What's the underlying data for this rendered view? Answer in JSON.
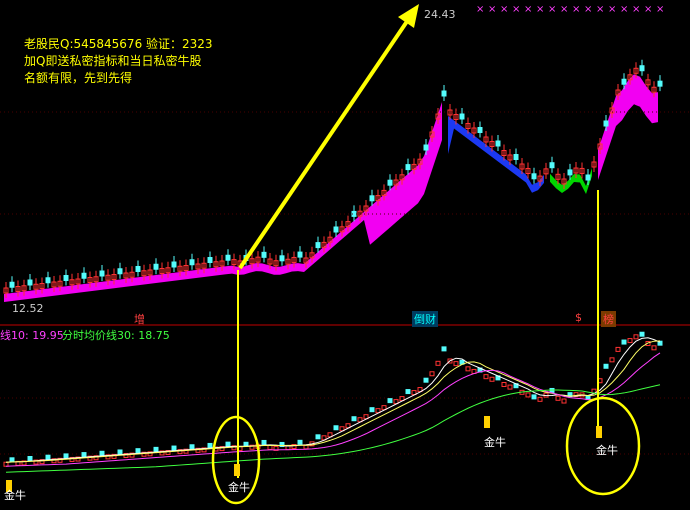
{
  "chart_data": {
    "type": "candlestick",
    "indicator_header": {
      "ma10_label": "线10: 19.95",
      "ma30_label": "分时均价线30: 18.75",
      "ma10_color": "#ff40ff",
      "ma30_color": "#40ff40"
    },
    "price_annotations": {
      "high_label": "24.43",
      "low_label": "12.52"
    },
    "signal_label": "金牛",
    "signal_count": 3,
    "section_tags": [
      {
        "text": "增",
        "color": "#ff4040"
      },
      {
        "text": "倒财",
        "color": "#00ffff"
      },
      {
        "text": "$",
        "color": "#ff4040"
      },
      {
        "text": "榜",
        "color": "#ff4040"
      }
    ],
    "colors": {
      "up": "#ff3232",
      "down": "#54fcfc",
      "ribbon_up": "#ff00ff",
      "ribbon_edge": "#ff0000",
      "ribbon_down_blue": "#1e3cff",
      "ribbon_down_green": "#00e000",
      "arrow": "#ffff00",
      "panel_divider": "#c00000"
    }
  },
  "promo": {
    "line1": "老股民Q:545845676 验证：2323",
    "line2": "加Q即送私密指标和当日私密牛股",
    "line3": "名额有限，先到先得"
  }
}
